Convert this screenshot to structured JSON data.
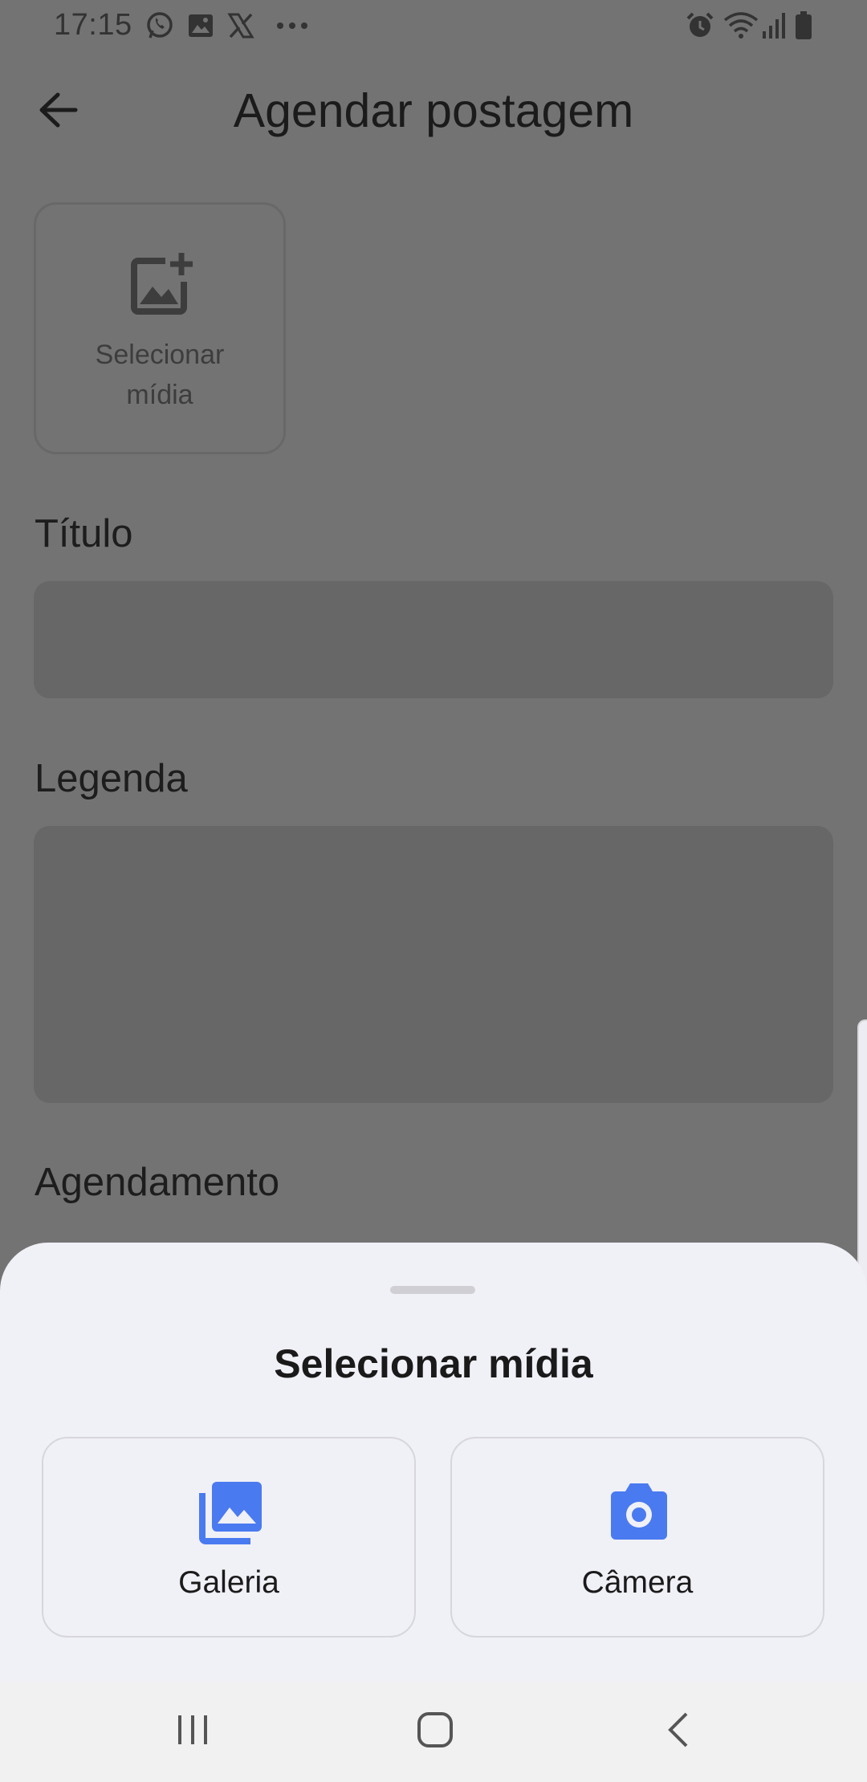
{
  "status_bar": {
    "time": "17:15",
    "notification_icons": [
      "whatsapp-icon",
      "gallery-icon",
      "x-icon",
      "more-icon"
    ],
    "system_icons": [
      "alarm-icon",
      "wifi-icon",
      "signal-icon",
      "battery-icon"
    ]
  },
  "app_bar": {
    "title": "Agendar postagem",
    "back_icon": "arrow-back-icon"
  },
  "form": {
    "media_tile_label": "Selecionar mídia",
    "title_label": "Título",
    "title_value": "",
    "caption_label": "Legenda",
    "caption_value": "",
    "schedule_label": "Agendamento"
  },
  "sheet": {
    "title": "Selecionar mídia",
    "options": [
      {
        "label": "Galeria",
        "icon": "photo-library-icon"
      },
      {
        "label": "Câmera",
        "icon": "camera-icon"
      }
    ]
  },
  "colors": {
    "accent": "#4a7af0",
    "scrim": "#737373",
    "sheet_background": "#f0f0f7"
  },
  "nav_bar": {
    "buttons": [
      "recents-icon",
      "home-icon",
      "back-icon"
    ]
  }
}
